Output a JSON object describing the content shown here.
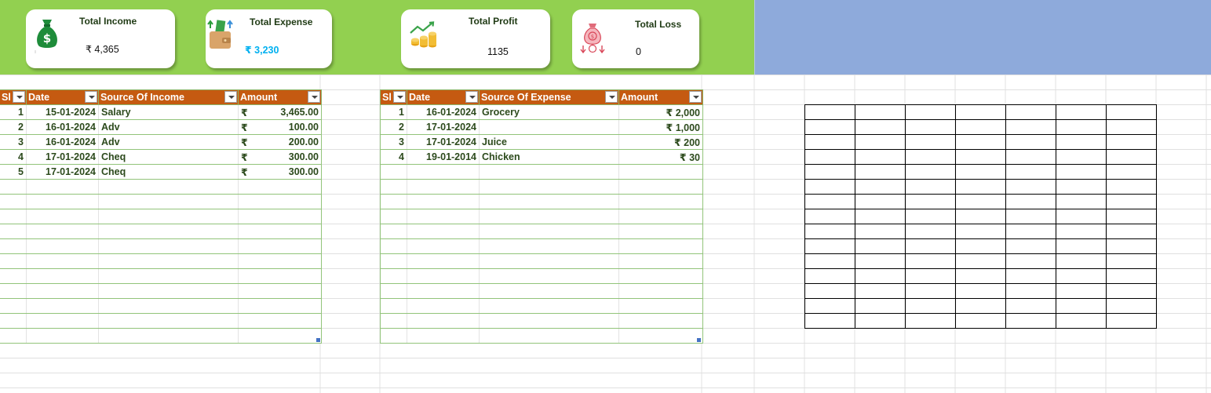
{
  "cards": [
    {
      "id": "income",
      "title": "Total Income",
      "value": "₹ 4,365",
      "value_color": "#111111",
      "icon": "money-bag-icon"
    },
    {
      "id": "expense",
      "title": "Total Expense",
      "value": "₹ 3,230",
      "value_color": "#00b0f0",
      "icon": "wallet-icon"
    },
    {
      "id": "profit",
      "title": "Total Profit",
      "value": "1135",
      "value_color": "#111111",
      "icon": "profit-coins-icon"
    },
    {
      "id": "loss",
      "title": "Total Loss",
      "value": "0",
      "value_color": "#111111",
      "icon": "loss-bag-icon"
    }
  ],
  "income_table": {
    "headers": [
      "Sl",
      "Date",
      "Source Of Income",
      "Amount"
    ],
    "currency": "₹",
    "rows": [
      {
        "sl": "1",
        "date": "15-01-2024",
        "source": "Salary",
        "amount": "3,465.00"
      },
      {
        "sl": "2",
        "date": "16-01-2024",
        "source": "Adv",
        "amount": "100.00"
      },
      {
        "sl": "3",
        "date": "16-01-2024",
        "source": "Adv",
        "amount": "200.00"
      },
      {
        "sl": "4",
        "date": "17-01-2024",
        "source": "Cheq",
        "amount": "300.00"
      },
      {
        "sl": "5",
        "date": "17-01-2024",
        "source": "Cheq",
        "amount": "300.00"
      }
    ]
  },
  "expense_table": {
    "headers": [
      "Sl",
      "Date",
      "Source Of Expense",
      "Amount"
    ],
    "rows": [
      {
        "sl": "1",
        "date": "16-01-2024",
        "source": "Grocery",
        "amount": "₹ 2,000"
      },
      {
        "sl": "2",
        "date": "17-01-2024",
        "source": "",
        "amount": "₹ 1,000"
      },
      {
        "sl": "3",
        "date": "17-01-2024",
        "source": "Juice",
        "amount": "₹ 200"
      },
      {
        "sl": "4",
        "date": "19-01-2014",
        "source": "Chicken",
        "amount": "₹ 30"
      }
    ]
  },
  "colors": {
    "banner_green": "#92d050",
    "banner_blue": "#8eaadb",
    "header_orange": "#c55a11",
    "row_border_green": "#92c47a",
    "gridline": "#e0e0e0"
  }
}
